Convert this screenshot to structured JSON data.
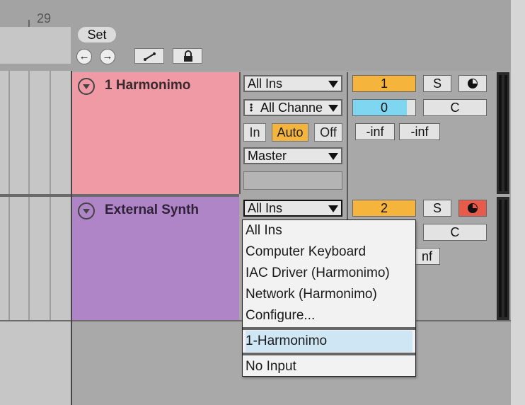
{
  "header": {
    "ruler_number": "29",
    "set_label": "Set",
    "nav_back_icon": "arrow-left-icon",
    "nav_forward_icon": "arrow-right-icon",
    "draw_icon": "pencil-icon",
    "lock_icon": "lock-icon"
  },
  "tracks": [
    {
      "name": "1 Harmonimo",
      "color": "#ef9aa5",
      "input_type": "All Ins",
      "input_channel": "All Channe",
      "monitor": [
        "In",
        "Auto",
        "Off"
      ],
      "monitor_active": "Auto",
      "output": "Master",
      "number": "1",
      "solo": "S",
      "volume": "0",
      "pan": "C",
      "peak_left": "-inf",
      "peak_right": "-inf"
    },
    {
      "name": "External Synth",
      "color": "#b085c8",
      "input_type": "All Ins",
      "number": "2",
      "solo": "S",
      "pan": "C",
      "peak_right_partial": "nf"
    }
  ],
  "dropdown": {
    "group1": [
      "All Ins",
      "Computer Keyboard",
      "IAC Driver (Harmonimo)",
      "Network (Harmonimo)",
      "Configure..."
    ],
    "group2": [
      "1-Harmonimo"
    ],
    "group3": [
      "No Input"
    ],
    "highlighted": "1-Harmonimo"
  },
  "colors": {
    "accent_orange": "#f5b43c",
    "accent_blue": "#7fd6f0",
    "arm_red": "#e85a4a",
    "track1": "#ef9aa5",
    "track2": "#b085c8"
  }
}
